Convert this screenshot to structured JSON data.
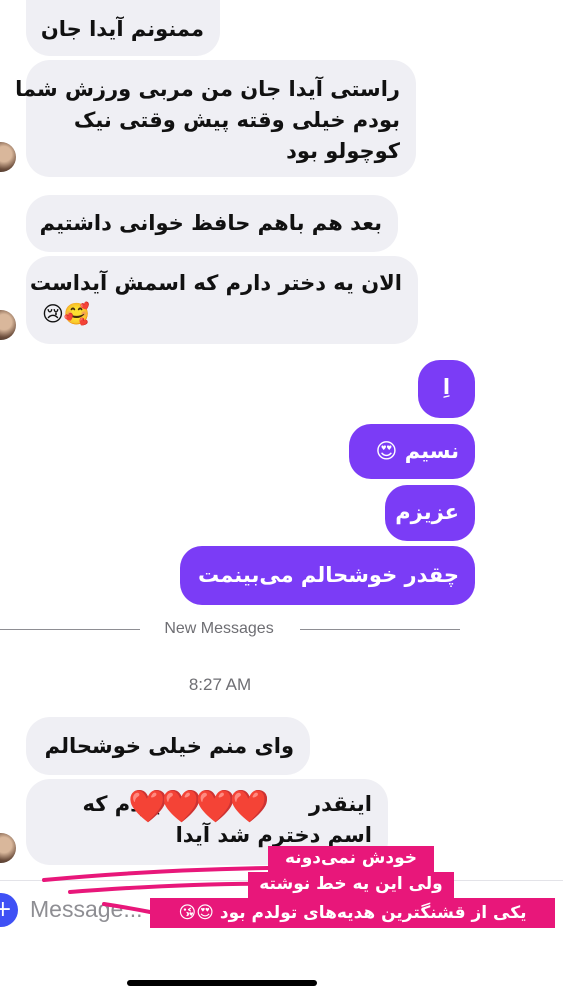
{
  "incoming_messages": [
    "ممنونم آیدا جان",
    "راستی آیدا جان من مربی ورزش شما",
    "بودم خیلی وقته پیش وقتی نیک",
    "کوچولو بود",
    "بعد هم باهم حافظ خوانی داشتیم",
    "الان یه دختر دارم که اسمش آیداست",
    "😢🥰"
  ],
  "outgoing_messages": [
    "اِ",
    "نسیم 😍",
    "عزیزم",
    "چقدر خوشحالم می‌بینمت"
  ],
  "divider": {
    "label": "New Messages"
  },
  "timestamp": "8:27 AM",
  "new_messages": [
    "وای منم خیلی خوشحالم",
    "اینقدر",
    "بودم که",
    "اسم دخترم شد آیدا"
  ],
  "hearts_text": "❤️❤️❤️❤️",
  "sticker_lines": [
    "خودش نمی‌دونه",
    "ولی این یه خط نوشته",
    "یکی از قشنگترین هدیه‌های تولدم بود 😍😘"
  ],
  "composer": {
    "placeholder": "Message...",
    "plus_icon": "+"
  },
  "colors": {
    "outgoing": "#7b3cf6",
    "incoming": "#efeff4",
    "sticker": "#e8177a"
  }
}
